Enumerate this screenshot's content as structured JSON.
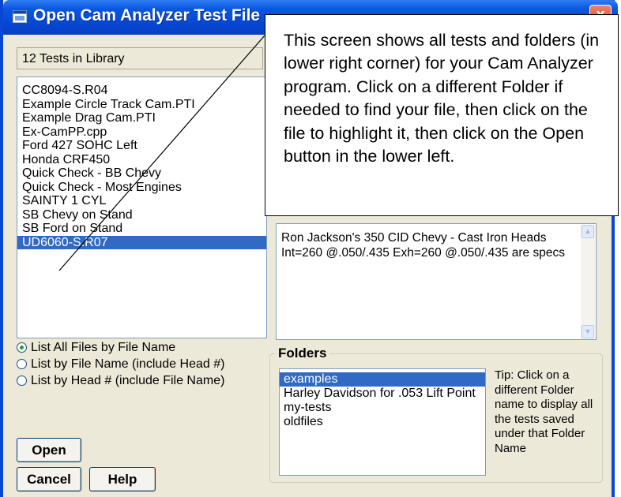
{
  "window": {
    "title": "Open Cam Analyzer Test File",
    "close_glyph": "x"
  },
  "library_status": "12 Tests in Library",
  "files": [
    {
      "name": "CC8094-S.R04",
      "selected": false
    },
    {
      "name": "Example Circle Track Cam.PTI",
      "selected": false
    },
    {
      "name": "Example Drag Cam.PTI",
      "selected": false
    },
    {
      "name": "Ex-CamPP.cpp",
      "selected": false
    },
    {
      "name": "Ford 427 SOHC Left",
      "selected": false
    },
    {
      "name": "Honda CRF450",
      "selected": false
    },
    {
      "name": "Quick Check - BB Chevy",
      "selected": false
    },
    {
      "name": "Quick Check - Most Engines",
      "selected": false
    },
    {
      "name": "SAINTY 1 CYL",
      "selected": false
    },
    {
      "name": "SB Chevy on Stand",
      "selected": false
    },
    {
      "name": "SB Ford on Stand",
      "selected": false
    },
    {
      "name": "UD6060-S.R07",
      "selected": true
    }
  ],
  "sort_options": [
    {
      "label": "List All Files by File Name",
      "checked": true
    },
    {
      "label": "List by File Name (include Head #)",
      "checked": false
    },
    {
      "label": "List by Head # (include File Name)",
      "checked": false
    }
  ],
  "buttons": {
    "open": "Open",
    "cancel": "Cancel",
    "help": "Help"
  },
  "notes": {
    "line1": "Ron Jackson's 350 CID Chevy - Cast Iron Heads",
    "line2": "Int=260 @.050/.435  Exh=260 @.050/.435  are specs"
  },
  "folders": {
    "label": "Folders",
    "items": [
      {
        "name": "examples",
        "selected": true
      },
      {
        "name": "Harley Davidson for .053 Lift Point",
        "selected": false
      },
      {
        "name": "my-tests",
        "selected": false
      },
      {
        "name": "oldfiles",
        "selected": false
      }
    ],
    "tip": "Tip:  Click on a different Folder name to display all the tests saved under that Folder Name"
  },
  "callout": {
    "text": "This screen shows all tests and folders (in lower right corner) for your Cam Analyzer program. Click on a different Folder if needed to find your file, then click on the file to highlight it, then click on the Open button in the lower left."
  },
  "colors": {
    "titlebar": "#0546d4",
    "selection": "#316ac5",
    "dialog_bg": "#ece9d8"
  }
}
